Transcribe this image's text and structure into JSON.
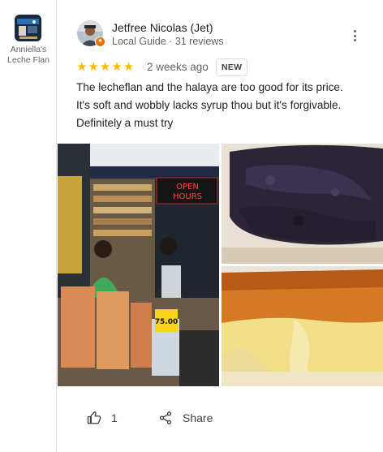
{
  "place": {
    "name_line1": "Anniella's",
    "name_line2": "Leche Flan"
  },
  "review": {
    "author": "Jetfree Nicolas (Jet)",
    "author_meta": "Local Guide · 31 reviews",
    "rating": 5,
    "stars": [
      "★",
      "★",
      "★",
      "★",
      "★"
    ],
    "date": "2 weeks ago",
    "badge": "NEW",
    "text_lines": [
      "The lecheflan and the halaya are too good for its price.",
      "It's soft and wobbly lacks syrup thou but it's forgivable.",
      "Definitely a must try"
    ],
    "photos": {
      "main_sign": [
        "OPEN",
        "HOURS"
      ],
      "main_price": "75.00"
    }
  },
  "actions": {
    "like_count": "1",
    "share_label": "Share"
  },
  "colors": {
    "star": "#fbbc04",
    "guide_badge": "#e8710a",
    "secondary_text": "#5f6368"
  },
  "icons": {
    "more": "more-vert-icon",
    "like": "thumb-up-icon",
    "share": "share-icon"
  }
}
